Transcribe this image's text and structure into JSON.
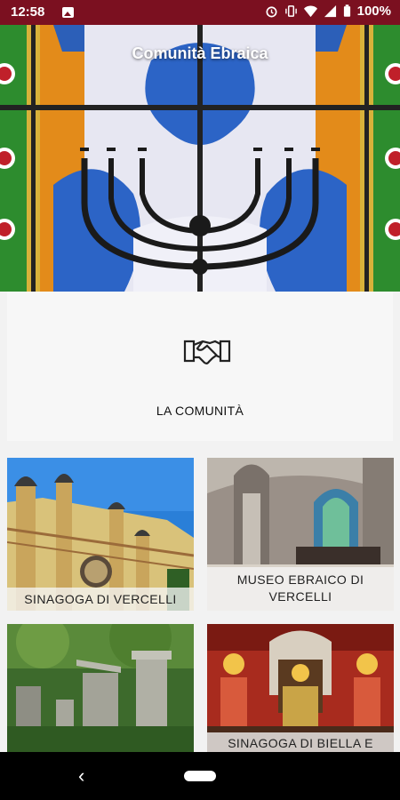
{
  "status_bar": {
    "time": "12:58",
    "battery": "100%",
    "icons": [
      "image-notification-icon",
      "alarm-icon",
      "vibrate-icon",
      "wifi-icon",
      "signal-icon",
      "battery-icon"
    ]
  },
  "header": {
    "title": "Comunità Ebraica"
  },
  "community": {
    "label": "LA COMUNITÀ",
    "icon": "handshake-icon"
  },
  "tiles": [
    {
      "label": "SINAGOGA DI VERCELLI"
    },
    {
      "label": "MUSEO EBRAICO DI VERCELLI"
    },
    {
      "label": ""
    },
    {
      "label": "SINAGOGA DI BIELLA E"
    }
  ],
  "colors": {
    "status_bar": "#7b1020",
    "card_bg": "#f7f7f7",
    "caption_bg": "#f5f5f5"
  }
}
